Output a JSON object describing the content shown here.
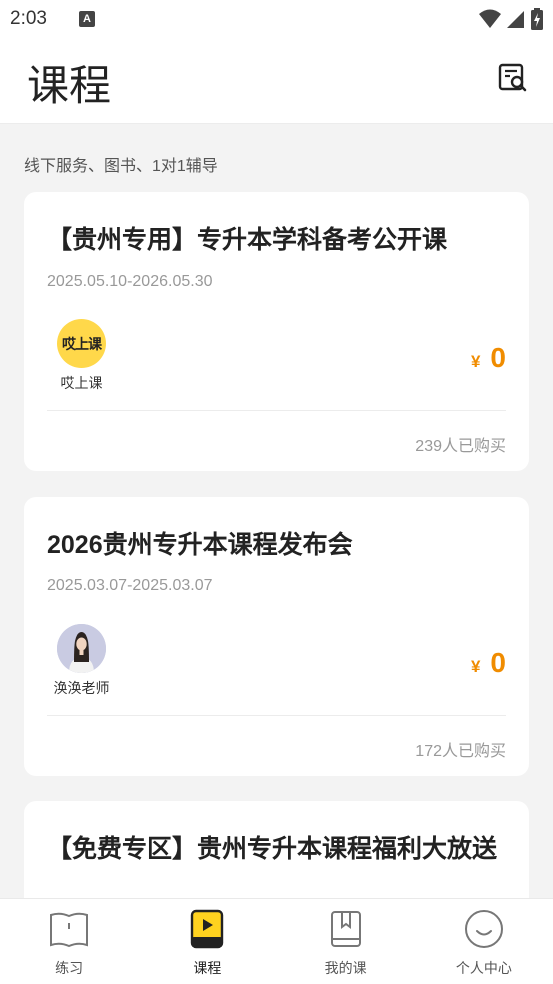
{
  "status": {
    "time": "2:03",
    "indicator": "A"
  },
  "header": {
    "title": "课程",
    "search_icon": "search-document-icon"
  },
  "section": {
    "label": "线下服务、图书、1对1辅导"
  },
  "courses": [
    {
      "title": "【贵州专用】专升本学科备考公开课",
      "date": "2025.05.10-2026.05.30",
      "teacher": "哎上课",
      "logo_text": "哎上课",
      "currency": "¥",
      "price": "0",
      "buyers": "239人已购买"
    },
    {
      "title": "2026贵州专升本课程发布会",
      "date": "2025.03.07-2025.03.07",
      "teacher": "涣涣老师",
      "currency": "¥",
      "price": "0",
      "buyers": "172人已购买"
    },
    {
      "title": "【免费专区】贵州专升本课程福利大放送"
    }
  ],
  "tabs": [
    {
      "label": "练习",
      "icon": "open-book-icon",
      "active": false
    },
    {
      "label": "课程",
      "icon": "play-book-icon",
      "active": true
    },
    {
      "label": "我的课",
      "icon": "bookmark-book-icon",
      "active": false
    },
    {
      "label": "个人中心",
      "icon": "smiley-face-icon",
      "active": false
    }
  ],
  "colors": {
    "accent": "#f08c00",
    "tab_active": "#ffd21f",
    "logo_bg": "#ffd84a",
    "background": "#f3f3f3"
  }
}
